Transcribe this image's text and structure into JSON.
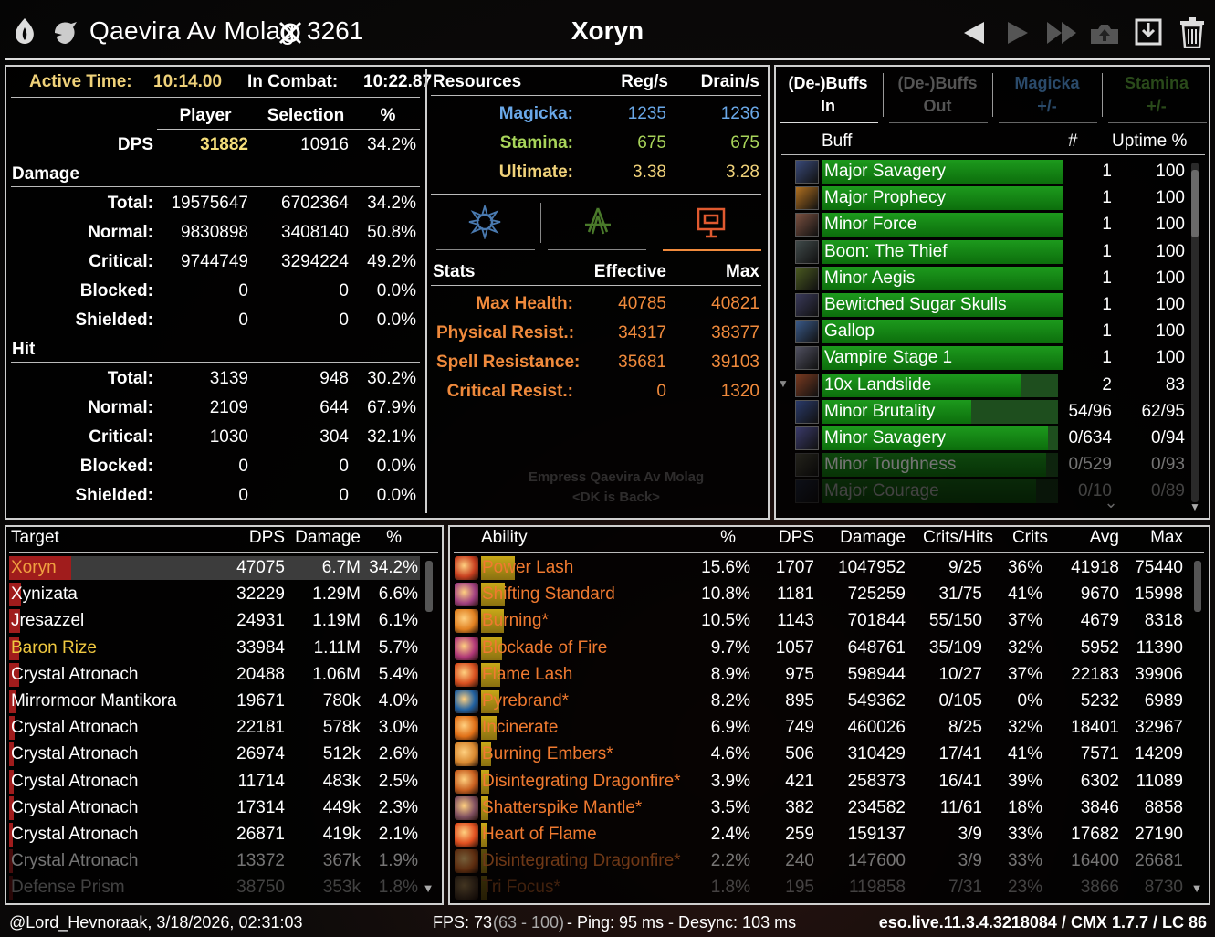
{
  "header": {
    "player_name": "Qaevira Av Molag",
    "champion_points": "3261",
    "target_title": "Xoryn"
  },
  "summary": {
    "active_time_label": "Active Time:",
    "active_time_value": "10:14.00",
    "in_combat_label": "In Combat:",
    "in_combat_value": "10:22.87",
    "col_player": "Player",
    "col_selection": "Selection",
    "col_pct": "%",
    "dps_label": "DPS",
    "dps_player": "31882",
    "dps_selection": "10916",
    "dps_pct": "34.2%",
    "damage_section": "Damage",
    "damage_rows": [
      {
        "label": "Total:",
        "player": "19575647",
        "selection": "6702364",
        "pct": "34.2%"
      },
      {
        "label": "Normal:",
        "player": "9830898",
        "selection": "3408140",
        "pct": "50.8%"
      },
      {
        "label": "Critical:",
        "player": "9744749",
        "selection": "3294224",
        "pct": "49.2%"
      },
      {
        "label": "Blocked:",
        "player": "0",
        "selection": "0",
        "pct": "0.0%"
      },
      {
        "label": "Shielded:",
        "player": "0",
        "selection": "0",
        "pct": "0.0%"
      }
    ],
    "hit_section": "Hit",
    "hit_rows": [
      {
        "label": "Total:",
        "player": "3139",
        "selection": "948",
        "pct": "30.2%"
      },
      {
        "label": "Normal:",
        "player": "2109",
        "selection": "644",
        "pct": "67.9%"
      },
      {
        "label": "Critical:",
        "player": "1030",
        "selection": "304",
        "pct": "32.1%"
      },
      {
        "label": "Blocked:",
        "player": "0",
        "selection": "0",
        "pct": "0.0%"
      },
      {
        "label": "Shielded:",
        "player": "0",
        "selection": "0",
        "pct": "0.0%"
      }
    ]
  },
  "resources": {
    "title": "Resources",
    "col_reg": "Reg/s",
    "col_drain": "Drain/s",
    "rows": [
      {
        "label": "Magicka:",
        "reg": "1235",
        "drain": "1236"
      },
      {
        "label": "Stamina:",
        "reg": "675",
        "drain": "675"
      },
      {
        "label": "Ultimate:",
        "reg": "3.38",
        "drain": "3.28"
      }
    ],
    "stats_title": "Stats",
    "col_effective": "Effective",
    "col_max": "Max",
    "stats": [
      {
        "label": "Max Health:",
        "effective": "40785",
        "max": "40821"
      },
      {
        "label": "Physical Resist.:",
        "effective": "34317",
        "max": "38377"
      },
      {
        "label": "Spell Resistance:",
        "effective": "35681",
        "max": "39103"
      },
      {
        "label": "Critical Resist.:",
        "effective": "0",
        "max": "1320"
      }
    ],
    "watermark_line1": "Empress Qaevira Av Molag",
    "watermark_line2": "<DK is Back>"
  },
  "buffs": {
    "tabs": [
      {
        "line1": "(De-)Buffs",
        "line2": "In"
      },
      {
        "line1": "(De-)Buffs",
        "line2": "Out"
      },
      {
        "line1": "Magicka",
        "line2": "+/-"
      },
      {
        "line1": "Stamina",
        "line2": "+/-"
      }
    ],
    "col_buff": "Buff",
    "col_count": "#",
    "col_uptime": "Uptime %",
    "rows": [
      {
        "name": "Major Savagery",
        "count": "1",
        "uptime": "100",
        "fill": 1.0
      },
      {
        "name": "Major Prophecy",
        "count": "1",
        "uptime": "100",
        "fill": 1.0
      },
      {
        "name": "Minor Force",
        "count": "1",
        "uptime": "100",
        "fill": 1.0
      },
      {
        "name": "Boon: The Thief",
        "count": "1",
        "uptime": "100",
        "fill": 1.0
      },
      {
        "name": "Minor Aegis",
        "count": "1",
        "uptime": "100",
        "fill": 1.0
      },
      {
        "name": "Bewitched Sugar Skulls",
        "count": "1",
        "uptime": "100",
        "fill": 1.0
      },
      {
        "name": "Gallop",
        "count": "1",
        "uptime": "100",
        "fill": 1.0
      },
      {
        "name": "Vampire Stage 1",
        "count": "1",
        "uptime": "100",
        "fill": 1.0
      },
      {
        "name": "10x Landslide",
        "count": "2",
        "uptime": "83",
        "fill": 0.83
      },
      {
        "name": "Minor Brutality",
        "count": "54/96",
        "uptime": "62/95",
        "fill": 0.62
      },
      {
        "name": "Minor Savagery",
        "count": "0/634",
        "uptime": "0/94",
        "fill": 0.94
      },
      {
        "name": "Minor Toughness",
        "count": "0/529",
        "uptime": "0/93",
        "fill": 0.93
      },
      {
        "name": "Major Courage",
        "count": "0/10",
        "uptime": "0/89",
        "fill": 0.89
      }
    ]
  },
  "targets": {
    "col_target": "Target",
    "col_dps": "DPS",
    "col_damage": "Damage",
    "col_pct": "%",
    "rows": [
      {
        "name": "Xoryn",
        "dps": "47075",
        "damage": "6.7M",
        "pct": "34.2%",
        "color": "#f0a040",
        "share": 0.342
      },
      {
        "name": "Xynizata",
        "dps": "32229",
        "damage": "1.29M",
        "pct": "6.6%",
        "color": "#ffffff",
        "share": 0.066
      },
      {
        "name": "Jresazzel",
        "dps": "24931",
        "damage": "1.19M",
        "pct": "6.1%",
        "color": "#ffffff",
        "share": 0.061
      },
      {
        "name": "Baron Rize",
        "dps": "33984",
        "damage": "1.11M",
        "pct": "5.7%",
        "color": "#f0c840",
        "share": 0.057
      },
      {
        "name": "Crystal Atronach",
        "dps": "20488",
        "damage": "1.06M",
        "pct": "5.4%",
        "color": "#ffffff",
        "share": 0.054
      },
      {
        "name": "Mirrormoor Mantikora",
        "dps": "19671",
        "damage": "780k",
        "pct": "4.0%",
        "color": "#ffffff",
        "share": 0.04
      },
      {
        "name": "Crystal Atronach",
        "dps": "22181",
        "damage": "578k",
        "pct": "3.0%",
        "color": "#ffffff",
        "share": 0.03
      },
      {
        "name": "Crystal Atronach",
        "dps": "26974",
        "damage": "512k",
        "pct": "2.6%",
        "color": "#ffffff",
        "share": 0.026
      },
      {
        "name": "Crystal Atronach",
        "dps": "11714",
        "damage": "483k",
        "pct": "2.5%",
        "color": "#ffffff",
        "share": 0.025
      },
      {
        "name": "Crystal Atronach",
        "dps": "17314",
        "damage": "449k",
        "pct": "2.3%",
        "color": "#ffffff",
        "share": 0.023
      },
      {
        "name": "Crystal Atronach",
        "dps": "26871",
        "damage": "419k",
        "pct": "2.1%",
        "color": "#ffffff",
        "share": 0.021
      },
      {
        "name": "Crystal Atronach",
        "dps": "13372",
        "damage": "367k",
        "pct": "1.9%",
        "color": "#ffffff",
        "share": 0.019
      },
      {
        "name": "Defense Prism",
        "dps": "38750",
        "damage": "353k",
        "pct": "1.8%",
        "color": "#ffffff",
        "share": 0.018
      }
    ]
  },
  "abilities": {
    "col_ability": "Ability",
    "col_pct": "%",
    "col_dps": "DPS",
    "col_damage": "Damage",
    "col_crits_hits": "Crits/Hits",
    "col_crits": "Crits",
    "col_avg": "Avg",
    "col_max": "Max",
    "rows": [
      {
        "name": "Power Lash",
        "pct": "15.6%",
        "dps": "1707",
        "damage": "1047952",
        "crits_hits": "9/25",
        "crits": "36%",
        "avg": "41918",
        "max": "75440",
        "share": 0.156,
        "icon": "#c84020"
      },
      {
        "name": "Shifting Standard",
        "pct": "10.8%",
        "dps": "1181",
        "damage": "725259",
        "crits_hits": "31/75",
        "crits": "41%",
        "avg": "9670",
        "max": "15998",
        "share": 0.108,
        "icon": "#a04080"
      },
      {
        "name": "Burning*",
        "pct": "10.5%",
        "dps": "1143",
        "damage": "701844",
        "crits_hits": "55/150",
        "crits": "37%",
        "avg": "4679",
        "max": "8318",
        "share": 0.105,
        "icon": "#e08020"
      },
      {
        "name": "Blockade of Fire",
        "pct": "9.7%",
        "dps": "1057",
        "damage": "648761",
        "crits_hits": "35/109",
        "crits": "32%",
        "avg": "5952",
        "max": "11390",
        "share": 0.097,
        "icon": "#b03878"
      },
      {
        "name": "Flame Lash",
        "pct": "8.9%",
        "dps": "975",
        "damage": "598944",
        "crits_hits": "10/27",
        "crits": "37%",
        "avg": "22183",
        "max": "39906",
        "share": 0.089,
        "icon": "#d85020"
      },
      {
        "name": "Pyrebrand*",
        "pct": "8.2%",
        "dps": "895",
        "damage": "549362",
        "crits_hits": "0/105",
        "crits": "0%",
        "avg": "5232",
        "max": "6989",
        "share": 0.082,
        "icon": "#2060a0"
      },
      {
        "name": "Incinerate",
        "pct": "6.9%",
        "dps": "749",
        "damage": "460026",
        "crits_hits": "8/25",
        "crits": "32%",
        "avg": "18401",
        "max": "32967",
        "share": 0.069,
        "icon": "#e07018"
      },
      {
        "name": "Burning Embers*",
        "pct": "4.6%",
        "dps": "506",
        "damage": "310429",
        "crits_hits": "17/41",
        "crits": "41%",
        "avg": "7571",
        "max": "14209",
        "share": 0.046,
        "icon": "#d88830"
      },
      {
        "name": "Disintegrating Dragonfire*",
        "pct": "3.9%",
        "dps": "421",
        "damage": "258373",
        "crits_hits": "16/41",
        "crits": "39%",
        "avg": "6302",
        "max": "11089",
        "share": 0.039,
        "icon": "#c86020"
      },
      {
        "name": "Shatterspike Mantle*",
        "pct": "3.5%",
        "dps": "382",
        "damage": "234582",
        "crits_hits": "11/61",
        "crits": "18%",
        "avg": "3846",
        "max": "8858",
        "share": 0.035,
        "icon": "#805060"
      },
      {
        "name": "Heart of Flame",
        "pct": "2.4%",
        "dps": "259",
        "damage": "159137",
        "crits_hits": "3/9",
        "crits": "33%",
        "avg": "17682",
        "max": "27190",
        "share": 0.024,
        "icon": "#e05020"
      },
      {
        "name": "Disintegrating Dragonfire*",
        "pct": "2.2%",
        "dps": "240",
        "damage": "147600",
        "crits_hits": "3/9",
        "crits": "33%",
        "avg": "16400",
        "max": "26681",
        "share": 0.022,
        "icon": "#c86020"
      },
      {
        "name": "Tri Focus*",
        "pct": "1.8%",
        "dps": "195",
        "damage": "119858",
        "crits_hits": "7/31",
        "crits": "23%",
        "avg": "3866",
        "max": "8730",
        "share": 0.018,
        "icon": "#806040"
      }
    ]
  },
  "footer": {
    "user_time": "@Lord_Hevnoraak, 3/18/2026, 02:31:03",
    "fps_label": "FPS: 73",
    "fps_range": "(63 - 100)",
    "net": "- Ping: 95 ms - Desync: 103 ms",
    "version": "eso.live.11.3.4.3218084 / CMX 1.7.7 / LC 86"
  }
}
